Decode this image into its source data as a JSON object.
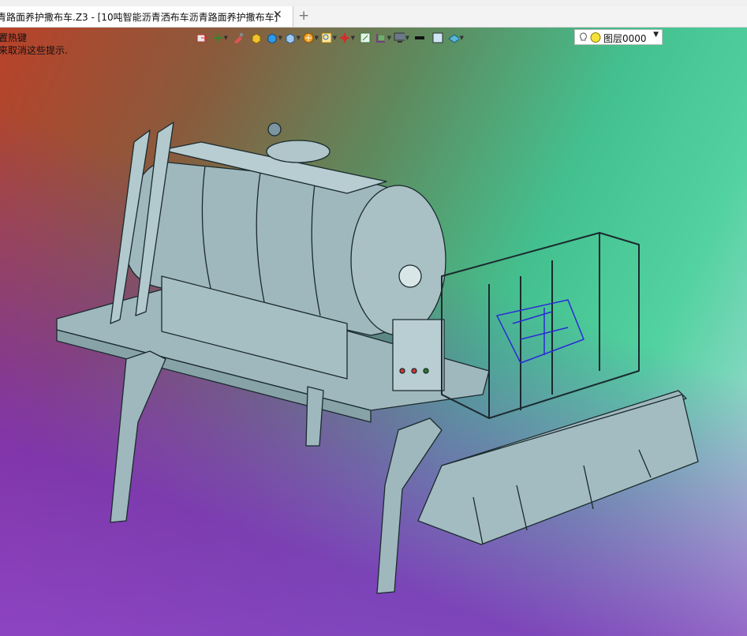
{
  "window": {
    "tab_title": "青路面养护撒布车.Z3 - [10吨智能沥青洒布车沥青路面养护撒布车]",
    "close_glyph": "✕",
    "add_glyph": "+"
  },
  "hints": {
    "line1": "置热键",
    "line2": "来取消这些提示."
  },
  "toolbar": {
    "icons": [
      "export-icon",
      "pan-icon",
      "brush-icon",
      "box-yellow-icon",
      "box-blue-icon",
      "view-cube-icon",
      "render-icon",
      "zoom-icon",
      "axis-icon",
      "fit-icon",
      "plane-icon",
      "monitor-icon",
      "line-color-icon",
      "fill-color-icon",
      "material-icon",
      "lightbulb-icon"
    ],
    "layer_value": "图层0000"
  },
  "colors": {
    "model_fill": "#9fb8bd",
    "model_stroke": "#1a2a2e",
    "accent_blue": "#2b2bd6"
  }
}
